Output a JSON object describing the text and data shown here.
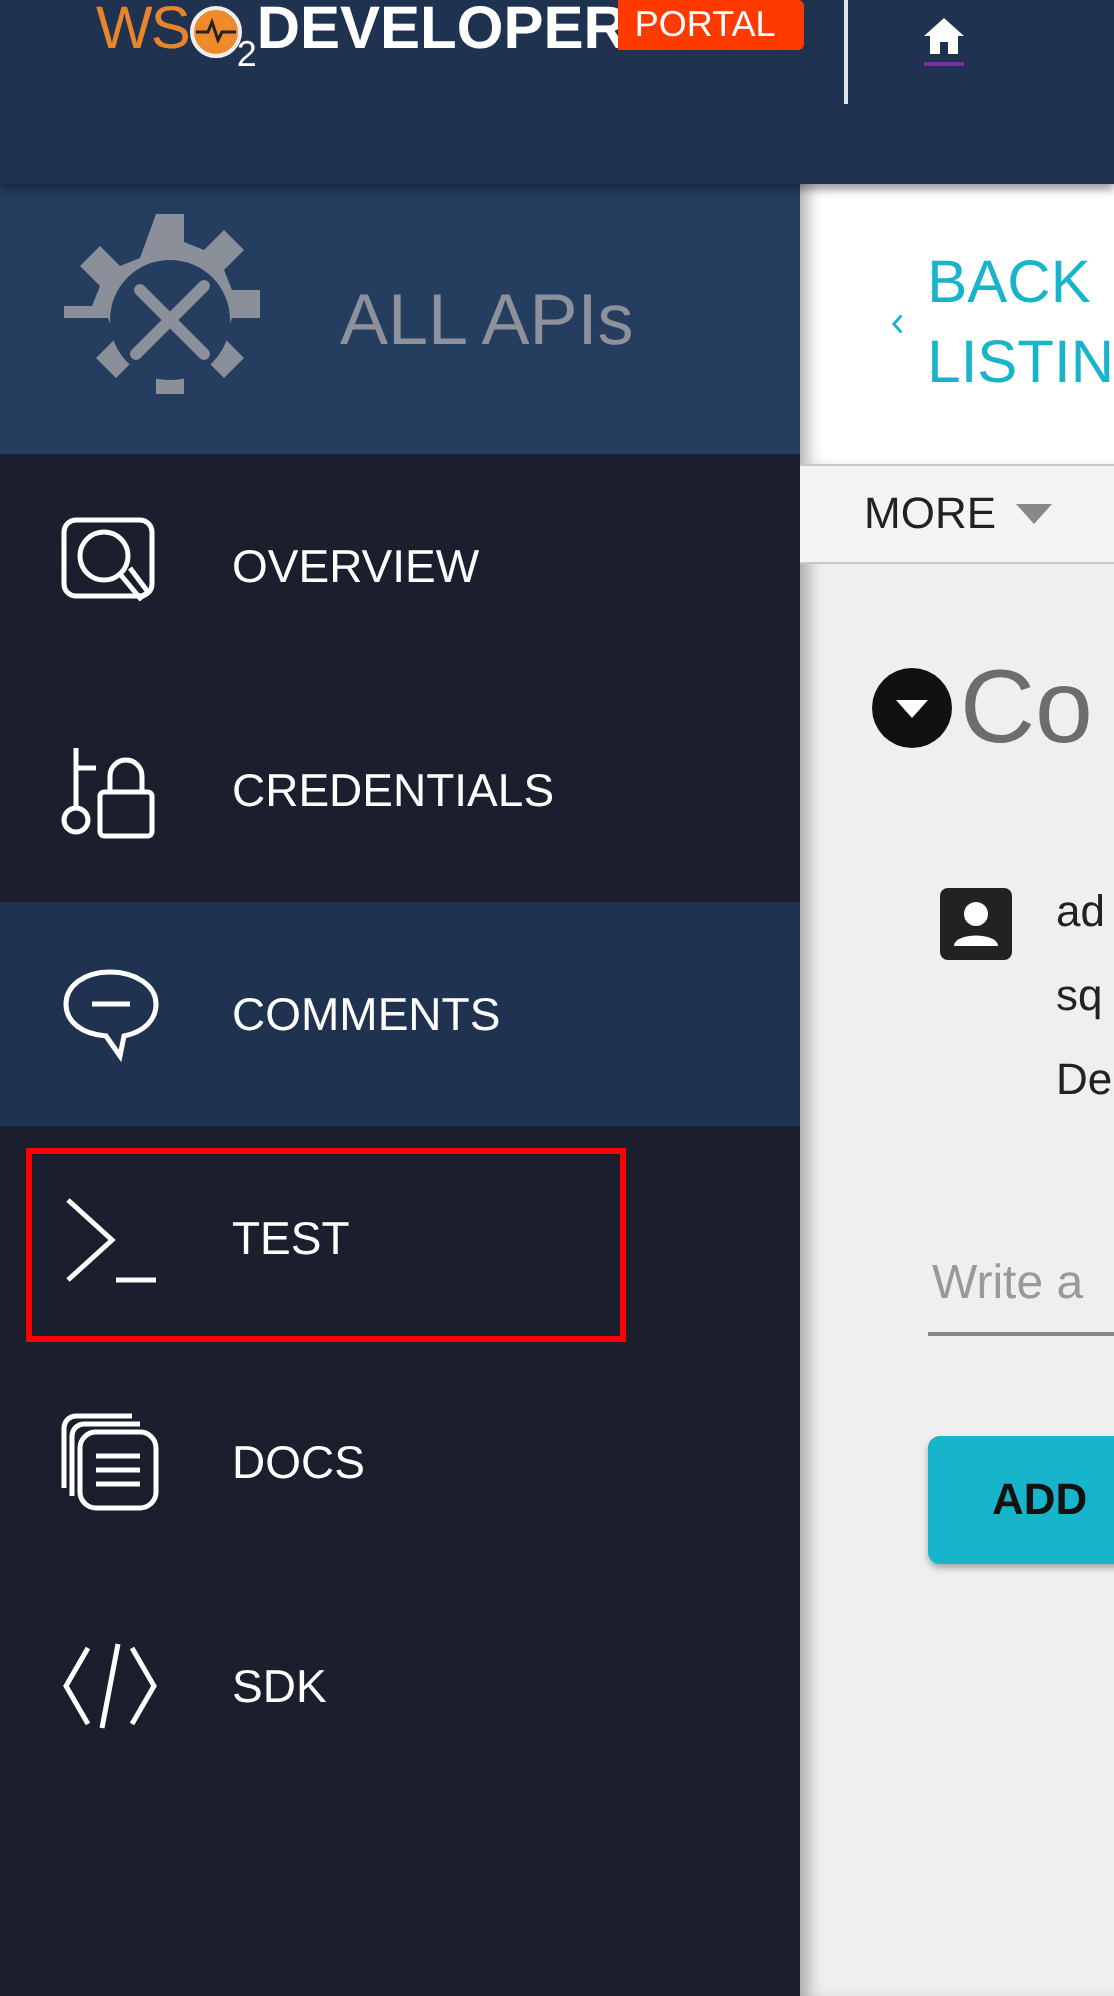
{
  "header": {
    "logo": {
      "prefix": "WS",
      "subscript": "2",
      "name": "DEVELOPER",
      "badge": "PORTAL"
    }
  },
  "sidebar": {
    "title": "ALL APIs",
    "items": [
      {
        "label": "OVERVIEW",
        "kind": "overview",
        "selected": false,
        "highlighted": false
      },
      {
        "label": "CREDENTIALS",
        "kind": "credentials",
        "selected": false,
        "highlighted": false
      },
      {
        "label": "COMMENTS",
        "kind": "comments",
        "selected": true,
        "highlighted": false
      },
      {
        "label": "TEST",
        "kind": "test",
        "selected": false,
        "highlighted": true
      },
      {
        "label": "DOCS",
        "kind": "docs",
        "selected": false,
        "highlighted": false
      },
      {
        "label": "SDK",
        "kind": "sdk",
        "selected": false,
        "highlighted": false
      }
    ]
  },
  "content": {
    "back_link": [
      "BACK",
      "LISTIN"
    ],
    "more_menu": "MORE",
    "section": {
      "title": "Co",
      "expanded": true
    },
    "comment": {
      "lines": [
        "ad",
        "sq",
        "De"
      ]
    },
    "input": {
      "placeholder": "Write a"
    },
    "add_button": "ADD"
  }
}
